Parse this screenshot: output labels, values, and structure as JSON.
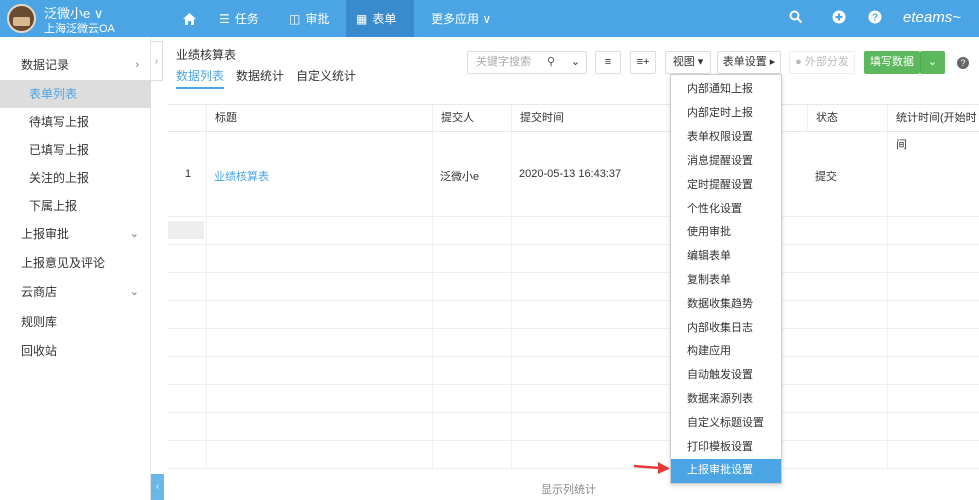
{
  "topbar": {
    "user_name": "泛微小e ∨",
    "org": "上海泛微云OA",
    "nav": [
      "任务",
      "审批",
      "表单",
      "更多应用 ∨"
    ],
    "brand": "eteams~"
  },
  "sidebar": {
    "items": [
      "数据记录",
      "表单列表",
      "待填写上报",
      "已填写上报",
      "关注的上报",
      "下属上报",
      "上报审批",
      "上报意见及评论",
      "云商店",
      "规则库",
      "回收站"
    ]
  },
  "page": {
    "title": "业绩核算表",
    "tabs": [
      "数据列表",
      "数据统计",
      "自定义统计"
    ]
  },
  "toolbar": {
    "search_placeholder": "关键字搜索",
    "view": "视图 ▾",
    "form_settings": "表单设置 ▸",
    "external": "外部分发",
    "fill": "填写数据"
  },
  "table": {
    "headers": [
      "标题",
      "提交人",
      "提交时间",
      "状态",
      "统计时间(开始时间"
    ],
    "rows": [
      {
        "no": "1",
        "title": "业绩核算表",
        "submitter": "泛微小e",
        "time": "2020-05-13 16:43:37",
        "status": "提交"
      }
    ]
  },
  "footer": "显示列统计",
  "menu": [
    "内部通知上报",
    "内部定时上报",
    "表单权限设置",
    "消息提醒设置",
    "定时提醒设置",
    "个性化设置",
    "使用审批",
    "编辑表单",
    "复制表单",
    "数据收集趋势",
    "内部收集日志",
    "构建应用",
    "自动触发设置",
    "数据来源列表",
    "自定义标题设置",
    "打印模板设置",
    "上报审批设置"
  ],
  "colors": {
    "accent": "#4ba5e4",
    "green": "#5cb85c",
    "arrow": "#e63a3a"
  }
}
